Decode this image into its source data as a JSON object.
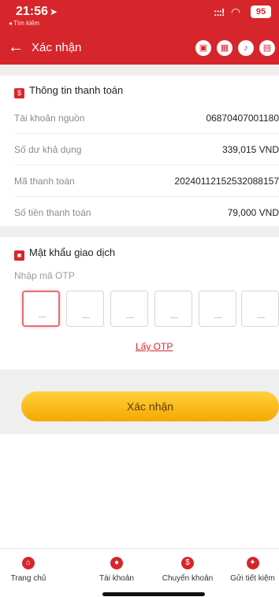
{
  "status_bar": {
    "time": "21:56",
    "back_app": "◂ Tìm kiếm",
    "signal": ":::!",
    "battery": "95"
  },
  "header": {
    "back_glyph": "←",
    "title": "Xác nhận",
    "icons": [
      "bus-icon",
      "qr-icon",
      "bell-icon",
      "gift-icon"
    ]
  },
  "payment_info": {
    "title": "Thông tin thanh toán",
    "rows": [
      {
        "label": "Tài khoản nguồn",
        "value": "06870407001180"
      },
      {
        "label": "Số dư khả dụng",
        "value": "339,015 VND"
      },
      {
        "label": "Mã thanh toán",
        "value": "20240112152532088157"
      },
      {
        "label": "Số tiền thanh toán",
        "value": "79,000 VND"
      }
    ]
  },
  "password": {
    "title": "Mật khẩu giao dịch",
    "otp_placeholder": "Nhập mã OTP",
    "otp_digits": [
      "",
      "",
      "",
      "",
      "",
      ""
    ],
    "get_otp": "Lấy OTP"
  },
  "confirm_button": "Xác nhận",
  "bottom_nav": [
    {
      "label": "Trang chủ",
      "icon": "home-icon"
    },
    {
      "label": "Tài khoản",
      "icon": "user-icon"
    },
    {
      "label": "Chuyển khoản",
      "icon": "transfer-icon"
    },
    {
      "label": "Gửi tiết kiệm",
      "icon": "piggy-bank-icon"
    }
  ],
  "colors": {
    "brand": "#d7262b",
    "button": "#f7b500",
    "background": "#efefef"
  }
}
